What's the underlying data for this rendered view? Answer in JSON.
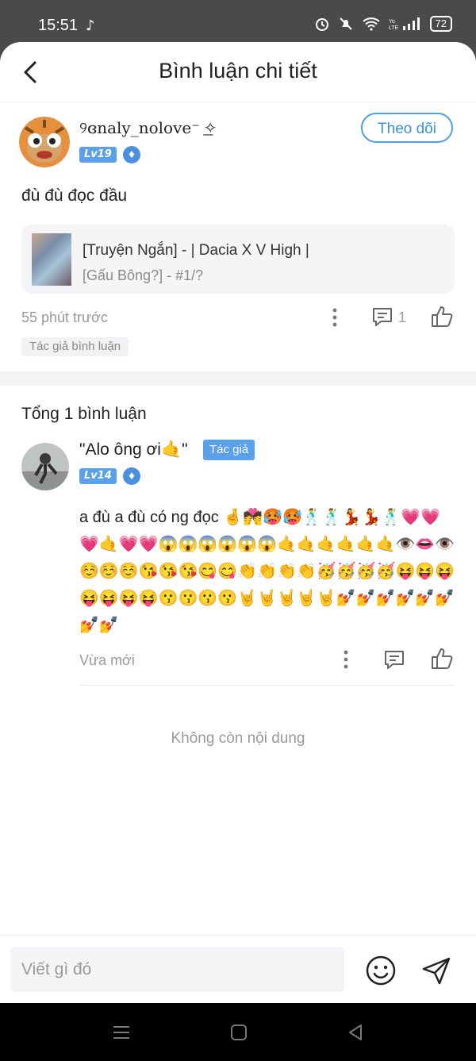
{
  "status_bar": {
    "time": "15:51",
    "battery": "72"
  },
  "header": {
    "title": "Bình luận chi tiết"
  },
  "comment": {
    "username": "୨ɞnaly_nolove⁻ ͟✧",
    "level": "Lv19",
    "follow_label": "Theo dõi",
    "text": "đù đù đọc đầu",
    "story": {
      "title_line1": "[Truyện Ngắn] - | Dacia X V High |",
      "title_line2": "[Gấu Bông?] - #1/?"
    },
    "time": "55 phút trước",
    "reply_count": "1",
    "author_tag": "Tác giả bình luận"
  },
  "replies_section": {
    "total": "Tổng 1 bình luận"
  },
  "reply": {
    "username": "\"Alo ông ơi🤙\"",
    "author_badge": "Tác giả",
    "level": "Lv14",
    "text": "a đù a đù có ng đọc 🤞💏🥵🥵🕺🕺💃💃🕺💗💗💗🤙💗💗😱😱😱😱😱😱🤙🤙🤙🤙🤙🤙👁️👄👁️☺️☺️☺️😘😘😘😋😋👏👏👏👏🥳🥳🥳🥳😝😝😝😝😝😝😝😗😗😗😗🤘🤘🤘🤘🤘💅💅💅💅💅💅💅💅",
    "time": "Vừa mới"
  },
  "footer": {
    "no_more": "Không còn nội dung",
    "input_placeholder": "Viết gì đó"
  }
}
